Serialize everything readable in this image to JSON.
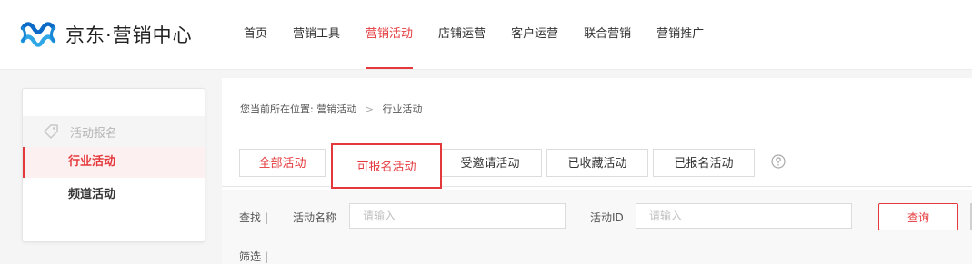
{
  "brand": {
    "name": "京东·营销中心",
    "accent": "#e4393c",
    "logo_colors": [
      "#0b69c7",
      "#2fa7e6"
    ]
  },
  "nav": {
    "items": [
      {
        "label": "首页"
      },
      {
        "label": "营销工具"
      },
      {
        "label": "营销活动",
        "active": true
      },
      {
        "label": "店铺运营"
      },
      {
        "label": "客户运营"
      },
      {
        "label": "联合营销"
      },
      {
        "label": "营销推广"
      }
    ]
  },
  "sidebar": {
    "group": {
      "label": "活动报名",
      "icon": "tag-icon"
    },
    "items": [
      {
        "label": "行业活动",
        "active": true
      },
      {
        "label": "频道活动"
      }
    ]
  },
  "breadcrumb": {
    "prefix": "您当前所在位置:",
    "parent": "营销活动",
    "separator": ">",
    "current": "行业活动"
  },
  "tabs": [
    {
      "label": "全部活动"
    },
    {
      "label": "可报名活动",
      "selected": true
    },
    {
      "label": "受邀请活动"
    },
    {
      "label": "已收藏活动"
    },
    {
      "label": "已报名活动"
    }
  ],
  "help_icon": "question-circle-icon",
  "search": {
    "section_label": "查找 |",
    "name_label": "活动名称",
    "name_placeholder": "请输入",
    "id_label": "活动ID",
    "id_placeholder": "请输入",
    "button_label": "查询"
  },
  "filter": {
    "section_label": "筛选 |"
  }
}
